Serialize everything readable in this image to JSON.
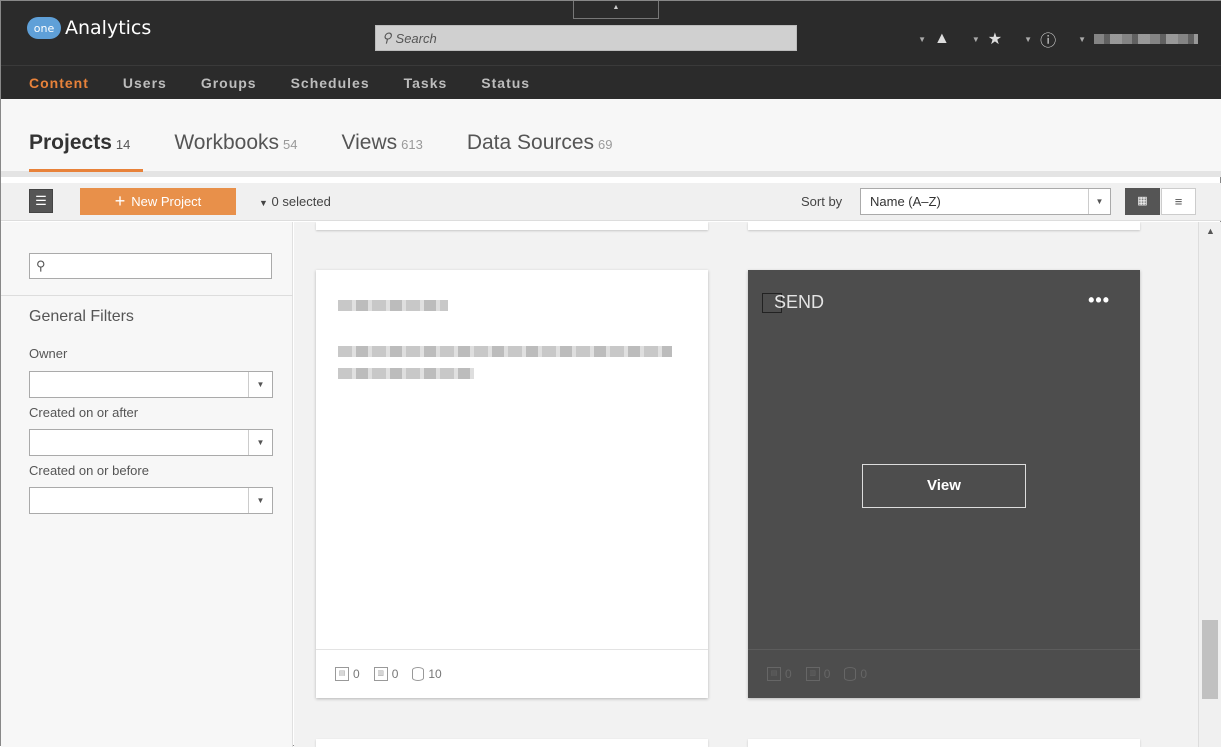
{
  "header": {
    "logo_text": "one",
    "app_name": "Analytics",
    "search_placeholder": "Search",
    "icons": [
      "alert-icon",
      "star-icon",
      "info-icon"
    ]
  },
  "nav": {
    "items": [
      "Content",
      "Users",
      "Groups",
      "Schedules",
      "Tasks",
      "Status"
    ],
    "active": "Content",
    "active_color": "#e8823a"
  },
  "tabs": [
    {
      "label": "Projects",
      "count": "14"
    },
    {
      "label": "Workbooks",
      "count": "54"
    },
    {
      "label": "Views",
      "count": "613"
    },
    {
      "label": "Data Sources",
      "count": "69"
    }
  ],
  "toolbar": {
    "new_label": "New Project",
    "selected_label": "0 selected",
    "sort_label": "Sort by",
    "sort_value": "Name (A–Z)"
  },
  "sidebar": {
    "title": "General Filters",
    "filters": [
      "Owner",
      "Created on or after",
      "Created on or before"
    ]
  },
  "cards": [
    {
      "title": "",
      "counts": [
        "0",
        "0",
        "10"
      ]
    },
    {
      "title": "SEND",
      "view_label": "View",
      "more": "•••",
      "counts": [
        "0",
        "0",
        "0"
      ]
    }
  ]
}
